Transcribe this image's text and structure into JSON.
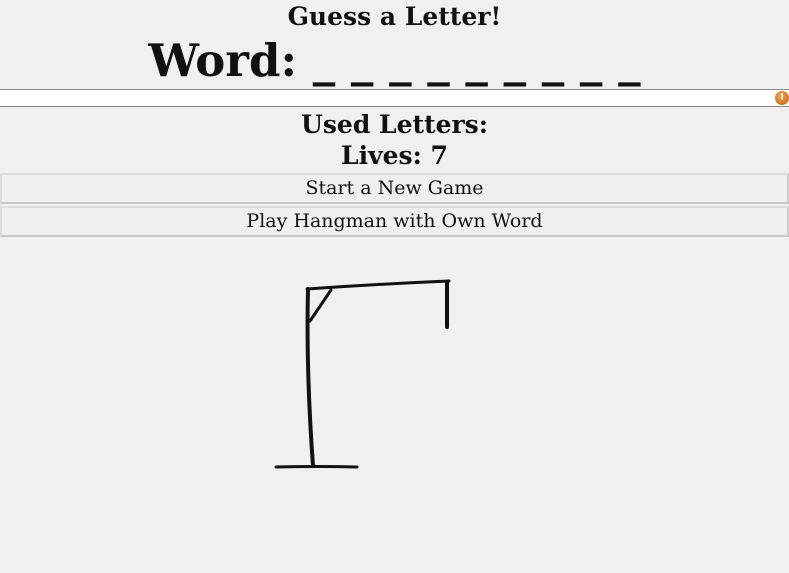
{
  "header": {
    "title": "Guess a Letter!",
    "word_label": "Word:",
    "word_display": "_ _ _ _ _ _ _ _ _"
  },
  "guess_input": {
    "value": "",
    "placeholder": "",
    "icon": "warning-icon",
    "icon_glyph": "!"
  },
  "status": {
    "used_letters_label": "Used Letters:",
    "used_letters": "",
    "lives_text": "Lives: 7"
  },
  "buttons": {
    "new_game": "Start a New Game",
    "own_word": "Play Hangman with Own Word"
  },
  "hangman": {
    "lives_remaining": 7,
    "stage": "gallows-only"
  }
}
